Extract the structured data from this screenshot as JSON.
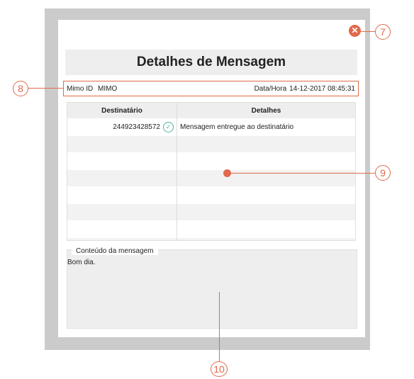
{
  "dialog": {
    "title": "Detalhes de Mensagem",
    "close_icon": "close-circle-icon",
    "info": {
      "mimo_id_label": "Mimo ID",
      "mimo_id_value": "MIMO",
      "datetime_label": "Data/Hora",
      "datetime_value": "14-12-2017 08:45:31"
    },
    "table": {
      "headers": [
        "Destinatário",
        "Detalhes"
      ],
      "rows": [
        {
          "recipient": "244923428572",
          "status_icon": "check-circle-icon",
          "details": "Mensagem entregue ao destinatário"
        }
      ]
    },
    "content": {
      "label": "Conteúdo da mensagem",
      "text": "Bom dia."
    }
  },
  "callouts": [
    "7",
    "8",
    "9",
    "10"
  ],
  "colors": {
    "accent": "#e06a4b",
    "check": "#4fb3a4"
  }
}
